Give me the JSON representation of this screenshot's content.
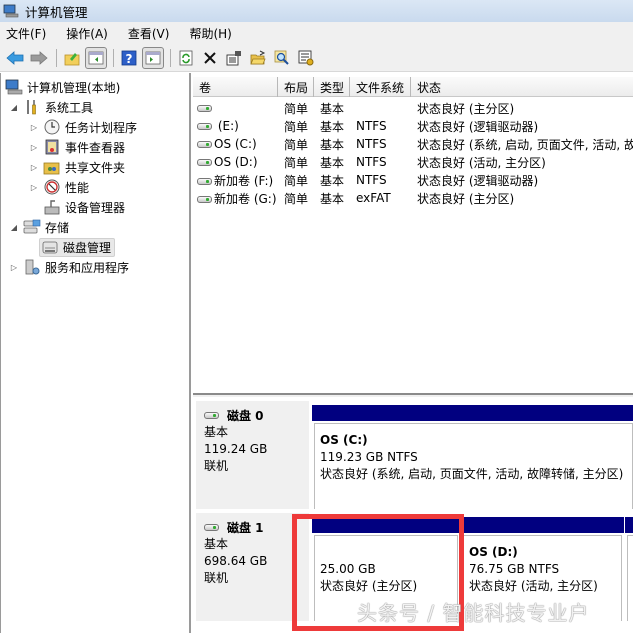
{
  "window": {
    "title": "计算机管理"
  },
  "menu": [
    "文件(F)",
    "操作(A)",
    "查看(V)",
    "帮助(H)"
  ],
  "toolbar": {
    "buttons": [
      {
        "name": "back",
        "icon": "back-arrow-icon"
      },
      {
        "name": "forward",
        "icon": "forward-arrow-icon"
      },
      {
        "name": "up-one-level",
        "icon": "up-folder-icon"
      },
      {
        "name": "show-hide-console-tree",
        "icon": "console-tree-icon"
      },
      {
        "name": "help",
        "icon": "help-icon"
      },
      {
        "name": "show-hide-action-pane",
        "icon": "action-pane-icon"
      },
      {
        "name": "refresh",
        "icon": "refresh-icon"
      },
      {
        "name": "delete",
        "icon": "delete-x-icon"
      },
      {
        "name": "properties",
        "icon": "properties-icon"
      },
      {
        "name": "open",
        "icon": "open-folder-icon"
      },
      {
        "name": "search",
        "icon": "magnifier-icon"
      },
      {
        "name": "settings",
        "icon": "settings-icon"
      }
    ]
  },
  "tree": {
    "root": "计算机管理(本地)",
    "items": [
      {
        "label": "系统工具",
        "expander": "expanded",
        "icon": "tools-icon",
        "level": 1
      },
      {
        "label": "任务计划程序",
        "expander": "collapsed",
        "icon": "clock-icon",
        "level": 2
      },
      {
        "label": "事件查看器",
        "expander": "collapsed",
        "icon": "event-viewer-icon",
        "level": 2
      },
      {
        "label": "共享文件夹",
        "expander": "collapsed",
        "icon": "shared-folder-icon",
        "level": 2
      },
      {
        "label": "性能",
        "expander": "collapsed",
        "icon": "performance-icon",
        "level": 2
      },
      {
        "label": "设备管理器",
        "expander": "none",
        "icon": "device-manager-icon",
        "level": 2
      },
      {
        "label": "存储",
        "expander": "expanded",
        "icon": "storage-icon",
        "level": 1
      },
      {
        "label": "磁盘管理",
        "expander": "none",
        "icon": "disk-management-icon",
        "level": 2,
        "selected": true
      },
      {
        "label": "服务和应用程序",
        "expander": "collapsed",
        "icon": "services-icon",
        "level": 1
      }
    ]
  },
  "volume_table": {
    "columns": [
      "卷",
      "布局",
      "类型",
      "文件系统",
      "状态"
    ],
    "rows": [
      {
        "volume": "",
        "layout": "简单",
        "type": "基本",
        "fs": "",
        "status": "状态良好 (主分区)"
      },
      {
        "volume": " (E:)",
        "layout": "简单",
        "type": "基本",
        "fs": "NTFS",
        "status": "状态良好 (逻辑驱动器)"
      },
      {
        "volume": "OS (C:)",
        "layout": "简单",
        "type": "基本",
        "fs": "NTFS",
        "status": "状态良好 (系统, 启动, 页面文件, 活动, 故"
      },
      {
        "volume": "OS (D:)",
        "layout": "简单",
        "type": "基本",
        "fs": "NTFS",
        "status": "状态良好 (活动, 主分区)"
      },
      {
        "volume": "新加卷 (F:)",
        "layout": "简单",
        "type": "基本",
        "fs": "NTFS",
        "status": "状态良好 (逻辑驱动器)"
      },
      {
        "volume": "新加卷 (G:)",
        "layout": "简单",
        "type": "基本",
        "fs": "exFAT",
        "status": "状态良好 (主分区)"
      }
    ]
  },
  "disks": [
    {
      "name": "磁盘 0",
      "kind": "基本",
      "size": "119.24 GB",
      "state": "联机",
      "partitions": [
        {
          "name": "OS  (C:)",
          "size": "119.23 GB NTFS",
          "status": "状态良好 (系统, 启动, 页面文件, 活动, 故障转储, 主分区)"
        }
      ]
    },
    {
      "name": "磁盘 1",
      "kind": "基本",
      "size": "698.64 GB",
      "state": "联机",
      "partitions": [
        {
          "name": "",
          "size": "25.00 GB",
          "status": "状态良好 (主分区)",
          "highlighted": true
        },
        {
          "name": "OS  (D:)",
          "size": "76.75 GB NTFS",
          "status": "状态良好 (活动, 主分区)"
        },
        {
          "name": "",
          "size": "",
          "status": ""
        }
      ]
    }
  ],
  "colors": {
    "partition_bar": "#010080",
    "highlight": "#ee3a3a"
  },
  "watermark": "头条号 / 智能科技专业户"
}
